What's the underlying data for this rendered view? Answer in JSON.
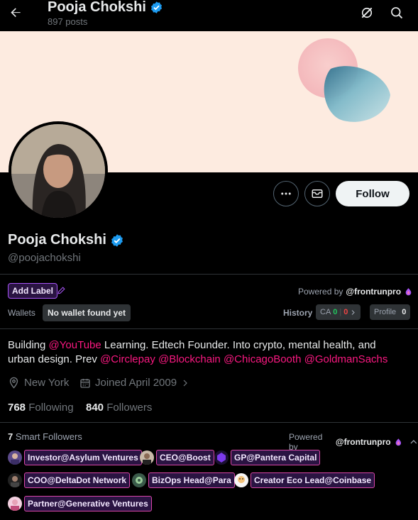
{
  "header": {
    "title": "Pooja Chokshi",
    "posts_count": "897 posts",
    "icons": [
      "back-arrow-icon",
      "verified-badge-icon",
      "grok-icon",
      "search-icon"
    ]
  },
  "profile": {
    "name": "Pooja Chokshi",
    "handle": "@poojachokshi",
    "follow_label": "Follow",
    "bio_parts": [
      {
        "text": "Building ",
        "mention": false
      },
      {
        "text": "@YouTube",
        "mention": true
      },
      {
        "text": " Learning. Edtech Founder. Into crypto, mental health, and urban design. Prev ",
        "mention": false
      },
      {
        "text": "@Circlepay",
        "mention": true
      },
      {
        "text": " ",
        "mention": false
      },
      {
        "text": "@Blockchain",
        "mention": true
      },
      {
        "text": " ",
        "mention": false
      },
      {
        "text": "@ChicagoBooth",
        "mention": true
      },
      {
        "text": " ",
        "mention": false
      },
      {
        "text": "@GoldmanSachs",
        "mention": true
      }
    ],
    "location": "New York",
    "joined": "Joined April 2009",
    "following_count": "768",
    "following_label": "Following",
    "followers_count": "840",
    "followers_label": "Followers"
  },
  "frontrun": {
    "add_label": "Add Label",
    "powered_by": "Powered by",
    "powered_by_handle": "@frontrunpro",
    "wallets_label": "Wallets",
    "wallet_status": "No wallet found yet",
    "history_label": "History",
    "ca_label": "CA",
    "ca_green": "0",
    "ca_red": "0",
    "profile_label": "Profile",
    "profile_value": "0"
  },
  "smart_followers": {
    "count": "7",
    "label": "Smart Followers",
    "powered_by": "Powered by",
    "powered_by_handle": "@frontrunpro",
    "items": [
      {
        "label": "Investor@Asylum Ventures"
      },
      {
        "label": "CEO@Boost"
      },
      {
        "label": "GP@Pantera Capital"
      },
      {
        "label": "COO@DeltaDot Network"
      },
      {
        "label": "BizOps Head@Para"
      },
      {
        "label": "Creator Eco Lead@Coinbase"
      },
      {
        "label": "Partner@Generative Ventures"
      }
    ]
  },
  "colors": {
    "accent_pink": "#f91880",
    "verified_blue": "#1d9bf0",
    "banner_bg": "#fdebe0",
    "chip_border": "#d946a8"
  }
}
